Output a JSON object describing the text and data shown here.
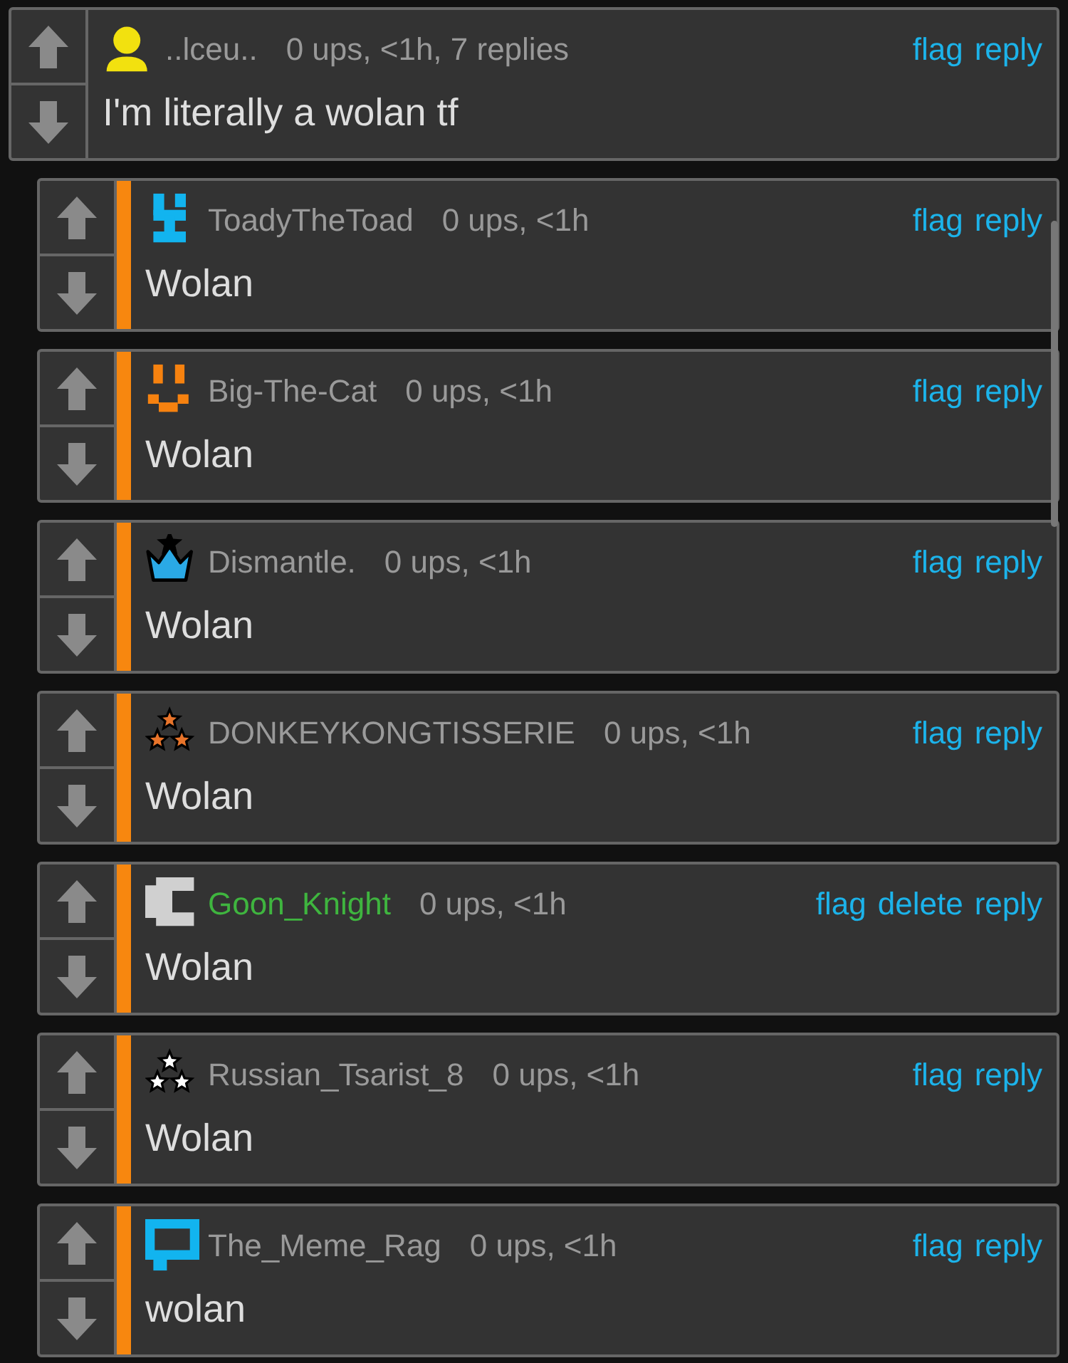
{
  "comment": {
    "avatar": {
      "kind": "person",
      "color": "#f2e10f"
    },
    "user": {
      "name": "..lceu..",
      "color": "#9a9a9a"
    },
    "meta": "0 ups, <1h, 7 replies",
    "actions": [
      "flag",
      "reply"
    ],
    "text": "I'm literally a wolan tf"
  },
  "replies": [
    {
      "avatar": {
        "kind": "toad",
        "color": "#12b4ef"
      },
      "user": {
        "name": "ToadyTheToad",
        "color": "#9a9a9a"
      },
      "meta": "0 ups, <1h",
      "actions": [
        "flag",
        "reply"
      ],
      "text": "Wolan"
    },
    {
      "avatar": {
        "kind": "face",
        "color": "#f7820f"
      },
      "user": {
        "name": "Big-The-Cat",
        "color": "#9a9a9a"
      },
      "meta": "0 ups, <1h",
      "actions": [
        "flag",
        "reply"
      ],
      "text": "Wolan"
    },
    {
      "avatar": {
        "kind": "crown",
        "color": "#2aa9e6"
      },
      "user": {
        "name": "Dismantle.",
        "color": "#9a9a9a"
      },
      "meta": "0 ups, <1h",
      "actions": [
        "flag",
        "reply"
      ],
      "text": "Wolan"
    },
    {
      "avatar": {
        "kind": "stars",
        "color": "#e8742a"
      },
      "user": {
        "name": "DONKEYKONGTISSERIE",
        "color": "#9a9a9a"
      },
      "meta": "0 ups, <1h",
      "actions": [
        "flag",
        "reply"
      ],
      "text": "Wolan"
    },
    {
      "avatar": {
        "kind": "blocky",
        "color": "#d0d0d0"
      },
      "user": {
        "name": "Goon_Knight",
        "color": "#3fb53f"
      },
      "meta": "0 ups, <1h",
      "actions": [
        "flag",
        "delete",
        "reply"
      ],
      "text": "Wolan"
    },
    {
      "avatar": {
        "kind": "stars",
        "color": "#ffffff"
      },
      "user": {
        "name": "Russian_Tsarist_8",
        "color": "#9a9a9a"
      },
      "meta": "0 ups, <1h",
      "actions": [
        "flag",
        "reply"
      ],
      "text": "Wolan"
    },
    {
      "avatar": {
        "kind": "frame",
        "color": "#12b4ef"
      },
      "user": {
        "name": "The_Meme_Rag",
        "color": "#9a9a9a"
      },
      "meta": "0 ups, <1h",
      "actions": [
        "flag",
        "reply"
      ],
      "text": "wolan"
    }
  ]
}
